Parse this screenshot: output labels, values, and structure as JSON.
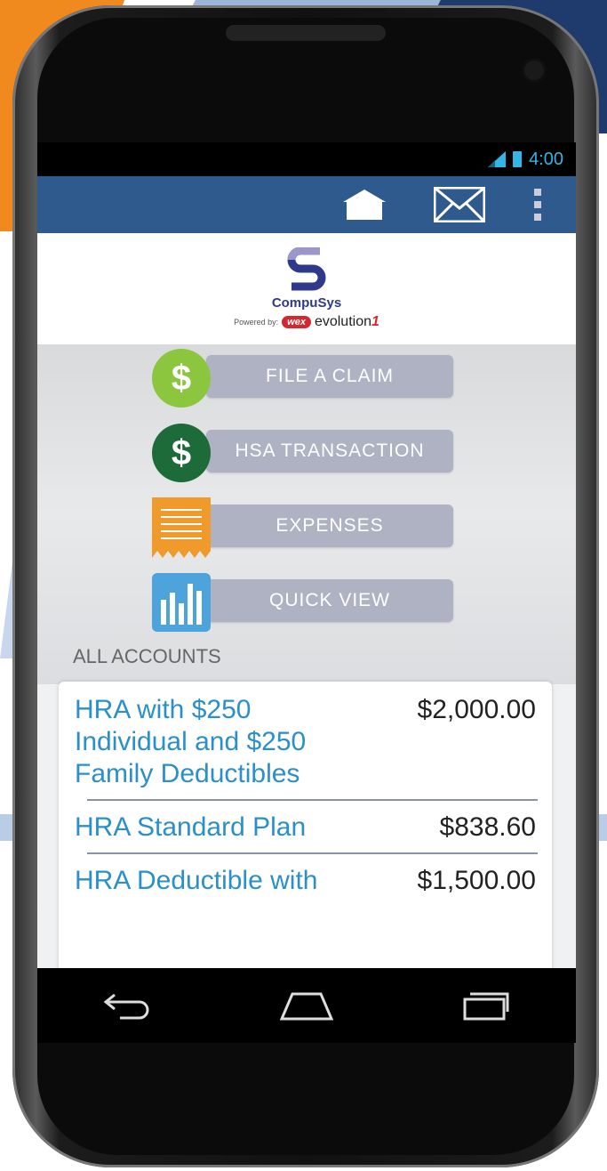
{
  "status": {
    "time": "4:00"
  },
  "actionbar": {
    "icons": [
      "home-icon",
      "mail-icon",
      "overflow-menu-icon"
    ]
  },
  "brand": {
    "name": "CompuSys",
    "powered_by": "Powered by:",
    "wex": "wex",
    "product": "evolution",
    "product_mark": "1"
  },
  "menu": [
    {
      "label": "FILE A CLAIM",
      "icon": "dollar-icon",
      "icon_color": "#8cc63f"
    },
    {
      "label": "HSA TRANSACTION",
      "icon": "dollar-icon",
      "icon_color": "#1e6b3a"
    },
    {
      "label": "EXPENSES",
      "icon": "receipt-icon",
      "icon_color": "#f09a2b"
    },
    {
      "label": "QUICK VIEW",
      "icon": "bar-chart-icon",
      "icon_color": "#4da3dc"
    }
  ],
  "section": {
    "title": "ALL ACCOUNTS"
  },
  "accounts": [
    {
      "name_lines": [
        "HRA with $250",
        "Individual and $250",
        "Family Deductibles"
      ],
      "amount": "$2,000.00"
    },
    {
      "name": "HRA Standard Plan",
      "amount": "$838.60"
    },
    {
      "name": "HRA Deductible with",
      "amount": "$1,500.00"
    }
  ],
  "colors": {
    "actionbar": "#2f5a8e",
    "link": "#2a8fca",
    "status": "#33b5e5"
  }
}
